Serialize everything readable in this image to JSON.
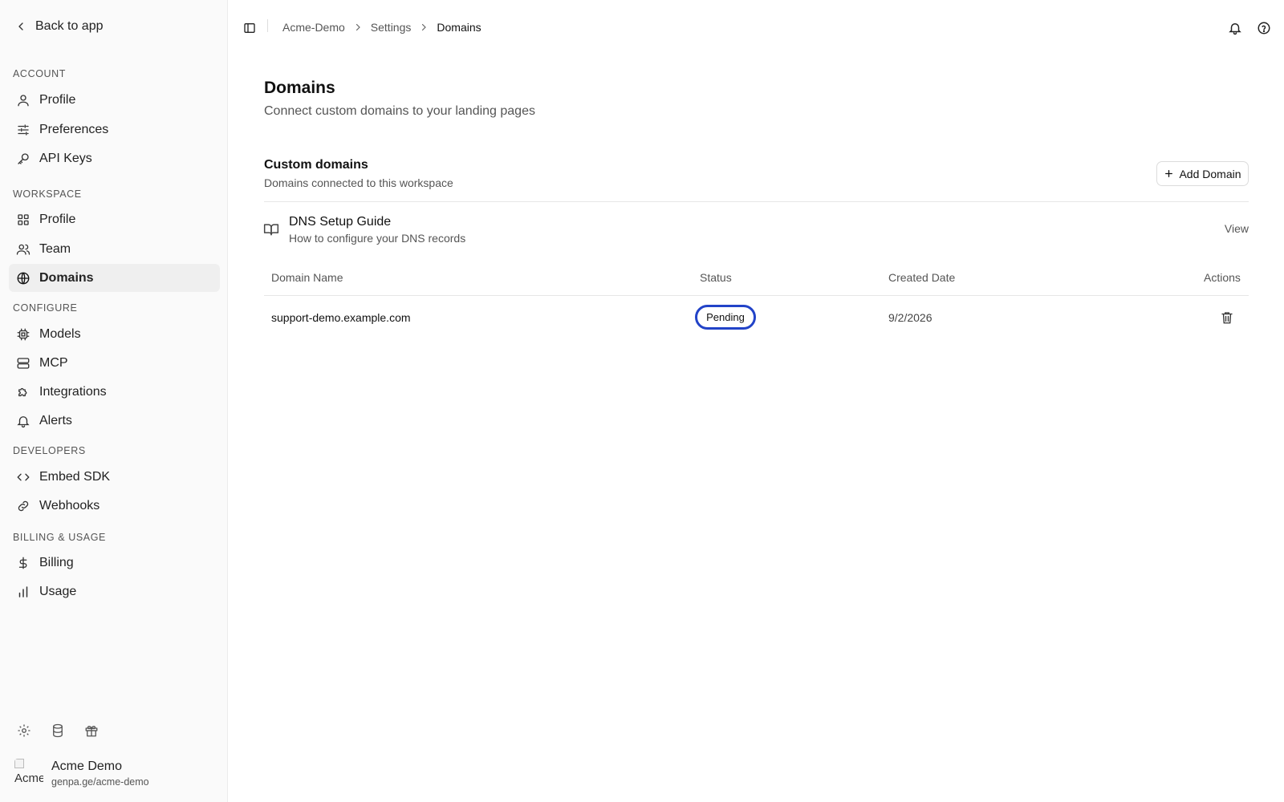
{
  "sidebar": {
    "back_label": "Back to app",
    "sections": [
      {
        "label": "ACCOUNT"
      },
      {
        "label": "WORKSPACE"
      },
      {
        "label": "CONFIGURE"
      },
      {
        "label": "DEVELOPERS"
      },
      {
        "label": "BILLING & USAGE"
      }
    ],
    "items": [
      {
        "label": "Profile",
        "icon": "user-icon"
      },
      {
        "label": "Preferences",
        "icon": "sliders-icon"
      },
      {
        "label": "API Keys",
        "icon": "key-icon"
      },
      {
        "label": "Profile",
        "icon": "grid-icon"
      },
      {
        "label": "Team",
        "icon": "users-icon"
      },
      {
        "label": "Domains",
        "icon": "globe-icon",
        "active": true
      },
      {
        "label": "Models",
        "icon": "cpu-icon"
      },
      {
        "label": "MCP",
        "icon": "server-icon"
      },
      {
        "label": "Integrations",
        "icon": "puzzle-icon"
      },
      {
        "label": "Alerts",
        "icon": "bell-icon"
      },
      {
        "label": "Embed SDK",
        "icon": "code-icon"
      },
      {
        "label": "Webhooks",
        "icon": "link-icon"
      },
      {
        "label": "Billing",
        "icon": "dollar-icon"
      },
      {
        "label": "Usage",
        "icon": "bar-chart-icon"
      }
    ],
    "bottom_icons": [
      "gear-icon",
      "database-icon",
      "gift-icon"
    ],
    "user": {
      "name": "Acme Demo",
      "url": "genpa.ge/acme-demo",
      "avatar_alt": "Acme"
    }
  },
  "topbar": {
    "breadcrumbs": [
      "Acme-Demo",
      "Settings",
      "Domains"
    ]
  },
  "main": {
    "title": "Domains",
    "subtitle": "Connect custom domains to your landing pages",
    "custom_domains": {
      "title": "Custom domains",
      "subtitle": "Domains connected to this workspace",
      "add_label": "Add Domain"
    },
    "guide": {
      "title": "DNS Setup Guide",
      "subtitle": "How to configure your DNS records",
      "view_label": "View"
    },
    "table": {
      "headers": [
        "Domain Name",
        "Status",
        "Created Date",
        "Actions"
      ],
      "rows": [
        {
          "domain": "support-demo.example.com",
          "status": "Pending",
          "created": "9/2/2026"
        }
      ]
    }
  },
  "colors": {
    "accent_focus": "#2243c8",
    "sidebar_bg": "#fafafa"
  }
}
